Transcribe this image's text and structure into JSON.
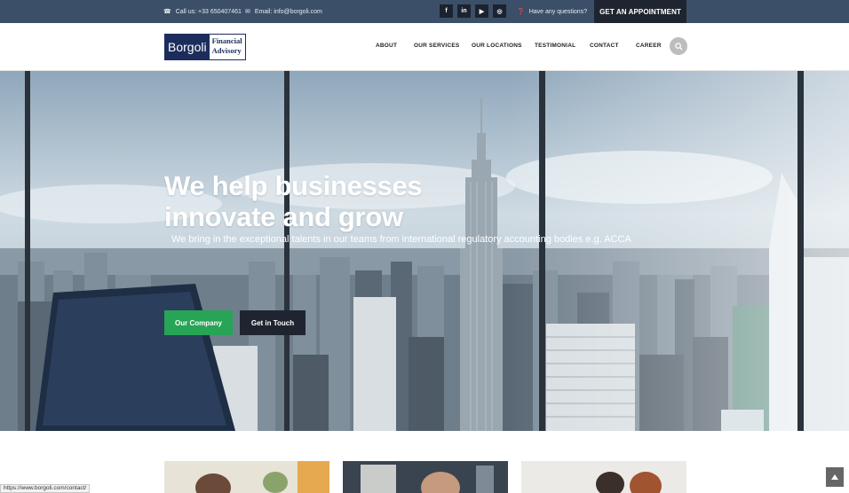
{
  "topbar": {
    "phone": "Call us: +33 650407461",
    "email": "Email: info@borgoli.com",
    "social": [
      {
        "name": "facebook",
        "glyph": "f"
      },
      {
        "name": "linkedin",
        "glyph": "in"
      },
      {
        "name": "youtube",
        "glyph": "▶"
      },
      {
        "name": "instagram",
        "glyph": "◎"
      }
    ],
    "questions": "Have any questions?",
    "appointment": "GET AN APPOINTMENT"
  },
  "logo": {
    "brand": "Borgoli",
    "tagline_1": "Financial",
    "tagline_2": "Advisory"
  },
  "nav": {
    "items": [
      "ABOUT",
      "OUR SERVICES",
      "OUR LOCATIONS",
      "TESTIMONIAL",
      "CONTACT",
      "CAREER"
    ]
  },
  "hero": {
    "title_line1": "We help businesses",
    "title_line2": "innovate and grow",
    "subtitle": "We bring in the exceptional talents in our teams from international regulatory accounting bodies e.g. ACCA",
    "primary_button": "Our Company",
    "secondary_button": "Get in Touch"
  },
  "status_bar": {
    "url": "https://www.borgoli.com/contact/"
  },
  "colors": {
    "topbar": "#3b4f68",
    "accent_green": "#27a456",
    "dark": "#1f2530",
    "logo_navy": "#1c2d5c"
  }
}
